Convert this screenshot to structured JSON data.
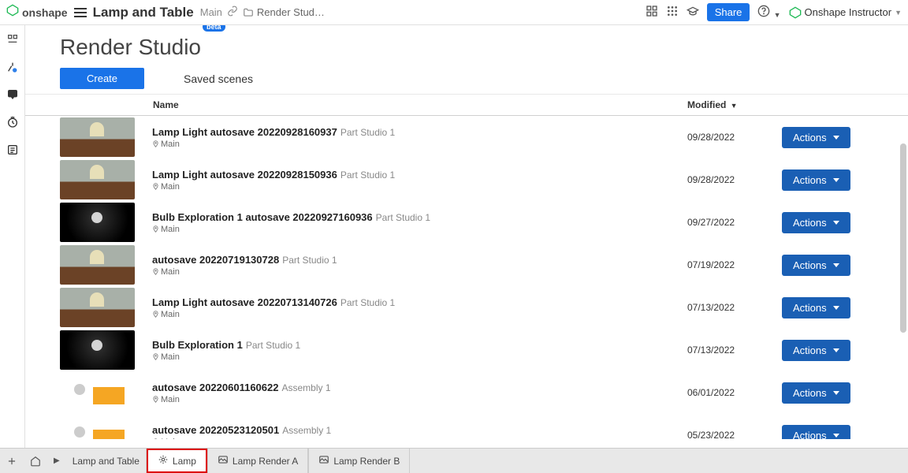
{
  "topbar": {
    "brand": "onshape",
    "doc_title": "Lamp and Table",
    "main_label": "Main",
    "breadcrumb": "Render Stud…",
    "share": "Share",
    "user_name": "Onshape Instructor"
  },
  "page": {
    "title": "Render Studio",
    "badge": "beta"
  },
  "toolbar": {
    "create": "Create",
    "saved_scenes": "Saved scenes"
  },
  "table": {
    "name_header": "Name",
    "modified_header": "Modified",
    "sort_indicator": "▼",
    "actions_label": "Actions",
    "location_label": "Main"
  },
  "scenes": [
    {
      "name": "Lamp Light autosave 20220928160937",
      "sub": "Part Studio 1",
      "modified": "09/28/2022",
      "thumb": "lamp"
    },
    {
      "name": "Lamp Light autosave 20220928150936",
      "sub": "Part Studio 1",
      "modified": "09/28/2022",
      "thumb": "lamp"
    },
    {
      "name": "Bulb Exploration 1 autosave 20220927160936",
      "sub": "Part Studio 1",
      "modified": "09/27/2022",
      "thumb": "dark"
    },
    {
      "name": "autosave 20220719130728",
      "sub": "Part Studio 1",
      "modified": "07/19/2022",
      "thumb": "lamp"
    },
    {
      "name": "Lamp Light autosave 20220713140726",
      "sub": "Part Studio 1",
      "modified": "07/13/2022",
      "thumb": "lamp"
    },
    {
      "name": "Bulb Exploration 1",
      "sub": "Part Studio 1",
      "modified": "07/13/2022",
      "thumb": "dark"
    },
    {
      "name": "autosave 20220601160622",
      "sub": "Assembly 1",
      "modified": "06/01/2022",
      "thumb": "assembly"
    },
    {
      "name": "autosave 20220523120501",
      "sub": "Assembly 1",
      "modified": "05/23/2022",
      "thumb": "assembly"
    }
  ],
  "bottom_tabs": {
    "breadcrumb": "Lamp and Table",
    "items": [
      {
        "label": "Lamp",
        "active": true,
        "icon": "render"
      },
      {
        "label": "Lamp Render A",
        "active": false,
        "icon": "image"
      },
      {
        "label": "Lamp Render B",
        "active": false,
        "icon": "image"
      }
    ]
  }
}
